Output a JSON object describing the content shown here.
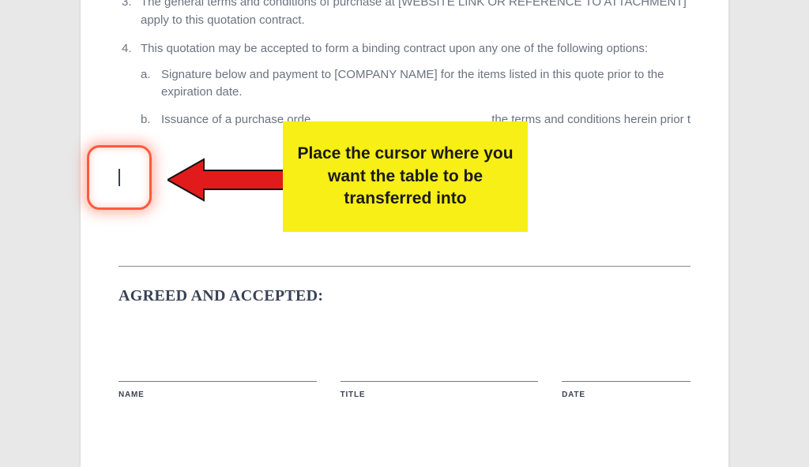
{
  "doc": {
    "list": {
      "item3": {
        "num": "3.",
        "text": "The general terms and conditions of purchase at [WEBSITE LINK OR REFERENCE TO ATTACHMENT] apply to this quotation contract."
      },
      "item4": {
        "num": "4.",
        "text": "This quotation may be accepted to form a binding contract upon any one of the following options:",
        "a": {
          "marker": "a.",
          "text": "Signature below and payment to [COMPANY NAME] for the items listed in this quote prior to the expiration date."
        },
        "b": {
          "marker": "b.",
          "left": "Issuance of a purchase orde",
          "right": " the terms and conditions herein prior t"
        }
      }
    },
    "agreed": "AGREED AND ACCEPTED:",
    "sig": {
      "name": "NAME",
      "title": "TITLE",
      "date": "DATE"
    }
  },
  "annotation": {
    "callout": "Place the cursor where you want the table to be transferred into"
  }
}
